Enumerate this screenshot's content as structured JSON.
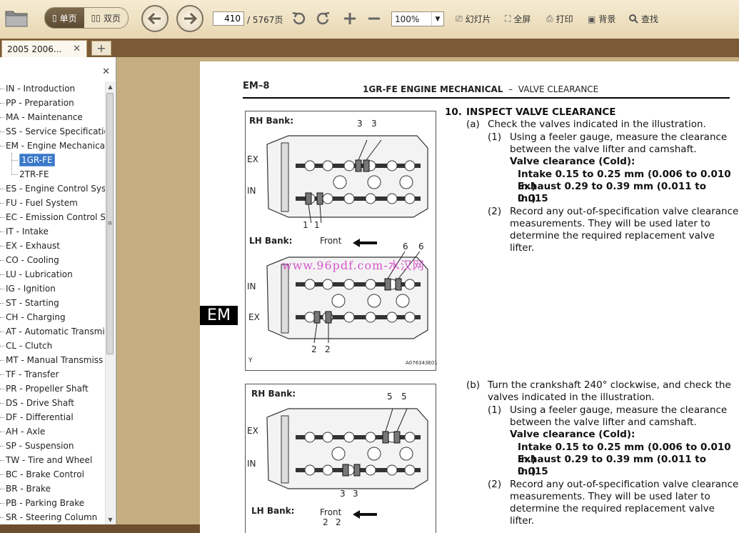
{
  "toolbar": {
    "view_single": "单页",
    "view_double": "双页",
    "current_page": "410",
    "page_total": "/ 5767页",
    "zoom": "100%",
    "slideshow": "幻灯片",
    "fullscreen": "全屏",
    "print": "打印",
    "background": "背景",
    "find": "查找"
  },
  "tabs": [
    {
      "label": "2005  2006..."
    }
  ],
  "sidebar": {
    "items": [
      {
        "label": "IN - Introduction"
      },
      {
        "label": "PP - Preparation"
      },
      {
        "label": "MA - Maintenance"
      },
      {
        "label": "SS - Service Specificatio"
      },
      {
        "label": "EM - Engine Mechanica"
      },
      {
        "label": "1GR-FE",
        "child": true,
        "selected": true
      },
      {
        "label": "2TR-FE",
        "child": true
      },
      {
        "label": "ES - Engine Control Syst"
      },
      {
        "label": "FU - Fuel System"
      },
      {
        "label": "EC - Emission Control S"
      },
      {
        "label": "IT - Intake"
      },
      {
        "label": "EX - Exhaust"
      },
      {
        "label": "CO - Cooling"
      },
      {
        "label": "LU - Lubrication"
      },
      {
        "label": "IG - Ignition"
      },
      {
        "label": "ST - Starting"
      },
      {
        "label": "CH - Charging"
      },
      {
        "label": "AT - Automatic Transmis"
      },
      {
        "label": "CL - Clutch"
      },
      {
        "label": "MT - Manual Transmiss"
      },
      {
        "label": "TF - Transfer"
      },
      {
        "label": "PR - Propeller Shaft"
      },
      {
        "label": "DS - Drive Shaft"
      },
      {
        "label": "DF - Differential"
      },
      {
        "label": "AH - Axle"
      },
      {
        "label": "SP - Suspension"
      },
      {
        "label": "TW - Tire and Wheel"
      },
      {
        "label": "BC - Brake Control"
      },
      {
        "label": "BR - Brake"
      },
      {
        "label": "PB - Parking Brake"
      },
      {
        "label": "SR - Steering Column"
      }
    ]
  },
  "document": {
    "section_code": "EM–8",
    "header_title": "1GR-FE ENGINE MECHANICAL",
    "header_sep": "–",
    "header_sub": "VALVE CLEARANCE",
    "side_tab": "EM",
    "watermark": "www.96pdf.com-水汉网",
    "fig1": {
      "rh_bank": "RH Bank:",
      "lh_bank": "LH Bank:",
      "ex": "EX",
      "in": "IN",
      "front": "Front",
      "callout_3": "3",
      "callout_1": "1",
      "callout_6": "6",
      "callout_2": "2",
      "corner": "Y",
      "code": "A076343E01"
    },
    "fig2": {
      "rh_bank": "RH Bank:",
      "lh_bank": "LH Bank:",
      "ex": "EX",
      "in": "IN",
      "front": "Front",
      "callout_5": "5",
      "callout_3": "3",
      "callout_2": "2"
    },
    "step10_num": "10.",
    "step10_title": "INSPECT VALVE CLEARANCE",
    "a_label": "(a)",
    "a_text": "Check the valves indicated in the illustration.",
    "a1_label": "(1)",
    "a1_text_1": "Using a feeler gauge, measure the clearance",
    "a1_text_2": "between the valve lifter and camshaft.",
    "vc_title": "Valve clearance (Cold):",
    "intake": "Intake 0.15 to 0.25 mm (0.006 to 0.010 in.)",
    "exhaust_1": "Exhaust 0.29 to 0.39 mm (0.011 to 0.015",
    "exhaust_2": "in.)",
    "a2_label": "(2)",
    "a2_text_1": "Record any out-of-specification valve clearance",
    "a2_text_2": "measurements. They will be used later to",
    "a2_text_3": "determine the required replacement valve lifter.",
    "b_label": "(b)",
    "b_text_1": "Turn the crankshaft 240° clockwise, and check the",
    "b_text_2": "valves indicated in the illustration.",
    "b1_label": "(1)",
    "b2_label": "(2)"
  }
}
